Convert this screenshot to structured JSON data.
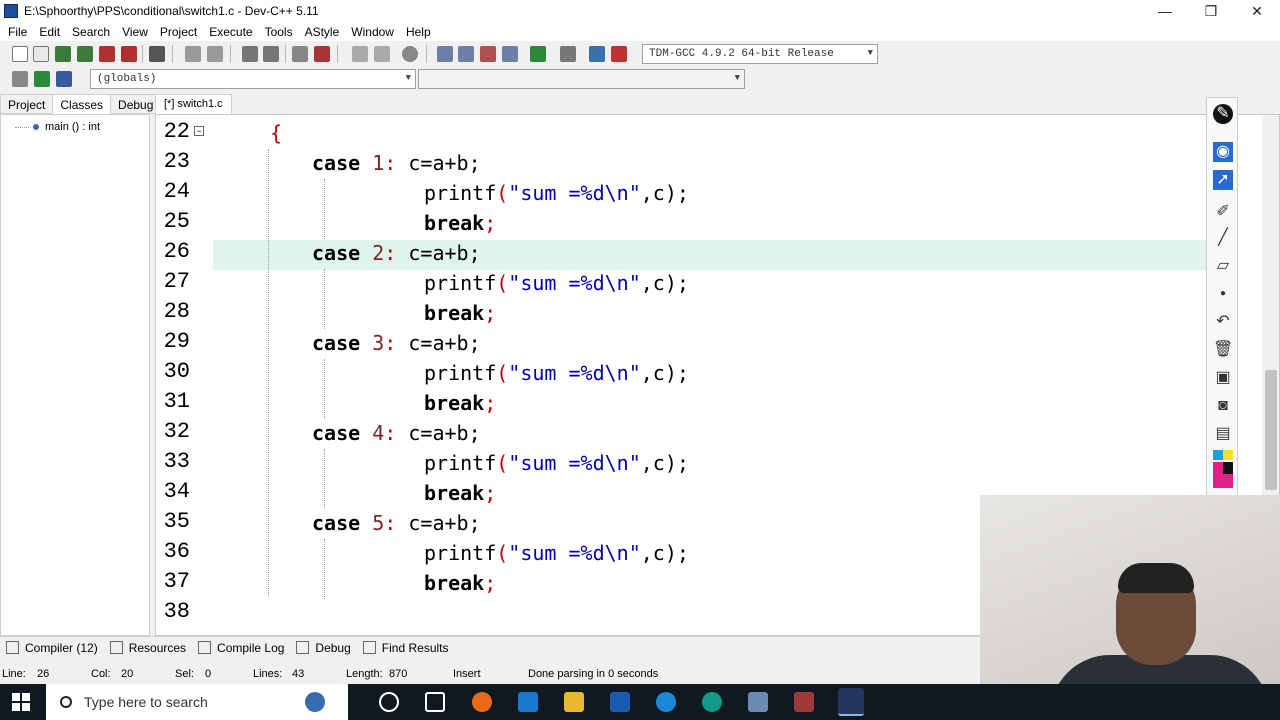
{
  "window": {
    "title": "E:\\Sphoorthy\\PPS\\conditional\\switch1.c - Dev-C++ 5.11",
    "buttons": [
      "—",
      "❐",
      "✕"
    ]
  },
  "menu": [
    "File",
    "Edit",
    "Search",
    "View",
    "Project",
    "Execute",
    "Tools",
    "AStyle",
    "Window",
    "Help"
  ],
  "toolbar": {
    "compiler_select": "TDM-GCC 4.9.2 64-bit Release",
    "globals_select": "(globals)",
    "function_select": ""
  },
  "left_panel": {
    "tabs": [
      "Project",
      "Classes",
      "Debug"
    ],
    "active_tab": "Classes",
    "tree_item": "main () : int"
  },
  "editor": {
    "tab": "[*] switch1.c",
    "current_line": 26,
    "lines": [
      {
        "no": "22",
        "text": "{"
      },
      {
        "no": "23",
        "kw": "case",
        "num": "1",
        "expr": "c=a+b;"
      },
      {
        "no": "24",
        "fn": "printf",
        "str": "\"sum =%d\\n\"",
        "rest": ",c);"
      },
      {
        "no": "25",
        "kw2": "break",
        "semi": ";"
      },
      {
        "no": "26",
        "kw": "case",
        "num": "2",
        "expr": "c=a+b;"
      },
      {
        "no": "27",
        "fn": "printf",
        "str": "\"sum =%d\\n\"",
        "rest": ",c);"
      },
      {
        "no": "28",
        "kw2": "break",
        "semi": ";"
      },
      {
        "no": "29",
        "kw": "case",
        "num": "3",
        "expr": "c=a+b;"
      },
      {
        "no": "30",
        "fn": "printf",
        "str": "\"sum =%d\\n\"",
        "rest": ",c);"
      },
      {
        "no": "31",
        "kw2": "break",
        "semi": ";"
      },
      {
        "no": "32",
        "kw": "case",
        "num": "4",
        "expr": "c=a+b;"
      },
      {
        "no": "33",
        "fn": "printf",
        "str": "\"sum =%d\\n\"",
        "rest": ",c);"
      },
      {
        "no": "34",
        "kw2": "break",
        "semi": ";"
      },
      {
        "no": "35",
        "kw": "case",
        "num": "5",
        "expr": "c=a+b;"
      },
      {
        "no": "36",
        "fn": "printf",
        "str": "\"sum =%d\\n\"",
        "rest": ",c);"
      },
      {
        "no": "37",
        "kw2": "break",
        "semi": ";"
      },
      {
        "no": "38",
        "text": ""
      }
    ]
  },
  "bottom_tabs": [
    "Compiler (12)",
    "Resources",
    "Compile Log",
    "Debug",
    "Find Results"
  ],
  "status": {
    "line_label": "Line:",
    "line": "26",
    "col_label": "Col:",
    "col": "20",
    "sel_label": "Sel:",
    "sel": "0",
    "lines_label": "Lines:",
    "lines": "43",
    "length_label": "Length:",
    "length": "870",
    "mode": "Insert",
    "message": "Done parsing in 0 seconds"
  },
  "taskbar": {
    "search_placeholder": "Type here to search"
  },
  "colors": {
    "current_line": "#dff5ec",
    "keyword": "#000000",
    "number": "#7a2424",
    "string": "#0000b0",
    "symbol": "#c00000"
  }
}
